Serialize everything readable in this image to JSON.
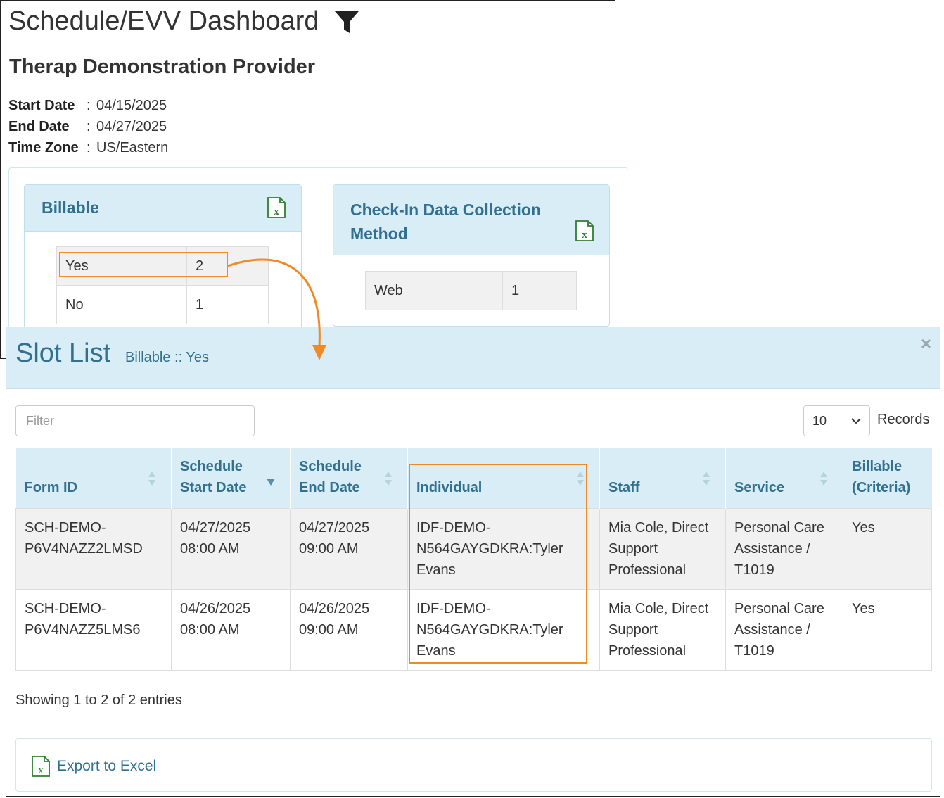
{
  "dashboard": {
    "title": "Schedule/EVV Dashboard",
    "filter_icon": "filter-icon",
    "provider": "Therap Demonstration Provider",
    "meta": [
      {
        "key": "Start Date",
        "sep": ":",
        "value": "04/15/2025"
      },
      {
        "key": "End Date",
        "sep": ":",
        "value": "04/27/2025"
      },
      {
        "key": "Time Zone",
        "sep": ":",
        "value": "US/Eastern"
      }
    ],
    "billable_panel": {
      "title": "Billable",
      "icon": "excel-icon",
      "rows": [
        {
          "label": "Yes",
          "count": "2"
        },
        {
          "label": "No",
          "count": "1"
        }
      ]
    },
    "checkin_panel": {
      "title_line1": "Check-In Data Collection",
      "title_line2": "Method",
      "icon": "excel-icon",
      "rows": [
        {
          "label": "Web",
          "count": "1"
        }
      ]
    }
  },
  "modal": {
    "title": "Slot List",
    "subtitle": "Billable :: Yes",
    "close": "×",
    "filter_placeholder": "Filter",
    "page_size": "10",
    "records_label": "Records",
    "columns": [
      {
        "line1": "",
        "line2": "Form ID"
      },
      {
        "line1": "Schedule",
        "line2": "Start Date"
      },
      {
        "line1": "Schedule",
        "line2": "End Date"
      },
      {
        "line1": "",
        "line2": "Individual"
      },
      {
        "line1": "",
        "line2": "Staff"
      },
      {
        "line1": "",
        "line2": "Service"
      },
      {
        "line1": "Billable",
        "line2": "(Criteria)"
      }
    ],
    "rows": [
      {
        "form_id": [
          "SCH-DEMO-",
          "P6V4NAZZ2LMSD"
        ],
        "start": [
          "04/27/2025",
          "08:00 AM"
        ],
        "end": [
          "04/27/2025",
          "09:00 AM"
        ],
        "individual": [
          "IDF-DEMO-",
          "N564GAYGDKRA:Tyler",
          "Evans"
        ],
        "staff": [
          "Mia Cole, Direct",
          "Support",
          "Professional"
        ],
        "service": [
          "Personal Care",
          "Assistance /",
          "T1019"
        ],
        "billable": "Yes"
      },
      {
        "form_id": [
          "SCH-DEMO-",
          "P6V4NAZZ5LMS6"
        ],
        "start": [
          "04/26/2025",
          "08:00 AM"
        ],
        "end": [
          "04/26/2025",
          "09:00 AM"
        ],
        "individual": [
          "IDF-DEMO-",
          "N564GAYGDKRA:Tyler",
          "Evans"
        ],
        "staff": [
          "Mia Cole, Direct",
          "Support",
          "Professional"
        ],
        "service": [
          "Personal Care",
          "Assistance /",
          "T1019"
        ],
        "billable": "Yes"
      }
    ],
    "showing": "Showing 1 to 2 of 2 entries",
    "export_label": "Export to Excel"
  },
  "colors": {
    "accent": "#31708f",
    "panel_bg": "#d9edf7",
    "highlight": "#f08a24",
    "excel_green": "#2e7d32"
  }
}
